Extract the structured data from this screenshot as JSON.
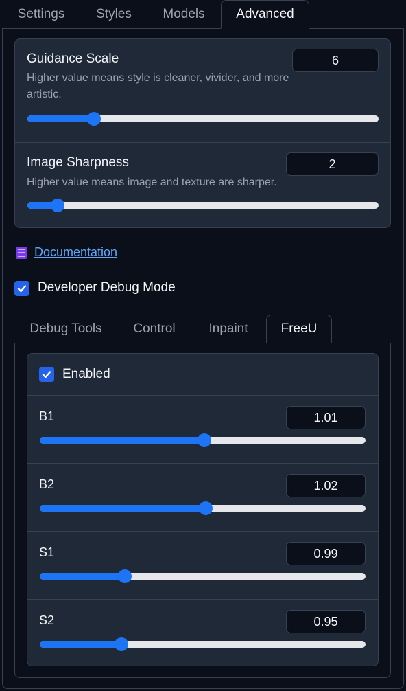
{
  "top_tabs": [
    {
      "label": "Settings"
    },
    {
      "label": "Styles"
    },
    {
      "label": "Models"
    },
    {
      "label": "Advanced"
    }
  ],
  "active_top_tab": "Advanced",
  "guidance": {
    "label": "Guidance Scale",
    "description": "Higher value means style is cleaner, vivider, and more artistic.",
    "value": "6",
    "slider_fraction": 0.19
  },
  "sharpness": {
    "label": "Image Sharpness",
    "description": "Higher value means image and texture are sharper.",
    "value": "2",
    "slider_fraction": 0.085
  },
  "documentation": {
    "icon": "notebook-icon",
    "label": "Documentation"
  },
  "debug_mode": {
    "label": "Developer Debug Mode",
    "checked": true
  },
  "inner_tabs": [
    {
      "label": "Debug Tools"
    },
    {
      "label": "Control"
    },
    {
      "label": "Inpaint"
    },
    {
      "label": "FreeU"
    }
  ],
  "active_inner_tab": "FreeU",
  "freeu": {
    "enabled_label": "Enabled",
    "enabled": true,
    "b1": {
      "label": "B1",
      "value": "1.01",
      "slider_fraction": 0.505
    },
    "b2": {
      "label": "B2",
      "value": "1.02",
      "slider_fraction": 0.51
    },
    "s1": {
      "label": "S1",
      "value": "0.99",
      "slider_fraction": 0.26
    },
    "s2": {
      "label": "S2",
      "value": "0.95",
      "slider_fraction": 0.25
    }
  },
  "colors": {
    "background": "#0b0f19",
    "panel": "#1f2937",
    "accent": "#1d74f5",
    "link": "#60a5fa"
  }
}
